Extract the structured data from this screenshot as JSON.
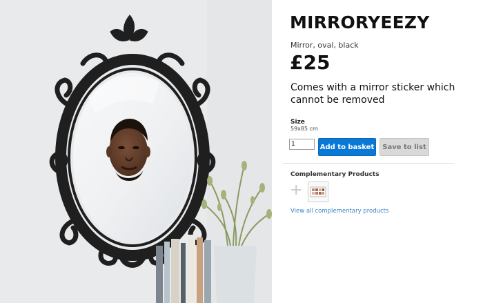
{
  "product": {
    "title": "MIRRORYEEZY",
    "subtitle": "Mirror, oval, black",
    "price": "£25",
    "description": "Comes with a mirror sticker which cannot be removed",
    "size_label": "Size",
    "size_value": "59x85 cm"
  },
  "purchase": {
    "quantity": "1",
    "add_to_basket_label": "Add to basket",
    "save_to_list_label": "Save to list"
  },
  "complementary": {
    "title": "Complementary Products",
    "plus_symbol": "+",
    "view_all_label": "View all complementary products"
  },
  "colors": {
    "primary_button": "#0a79d6",
    "secondary_button": "#d9d9d9",
    "link": "#3b86c7",
    "mirror_frame": "#1f1f1f"
  },
  "icons": {
    "plus": "plus-icon",
    "product_thumbnail": "makeup-palette-thumbnail"
  }
}
